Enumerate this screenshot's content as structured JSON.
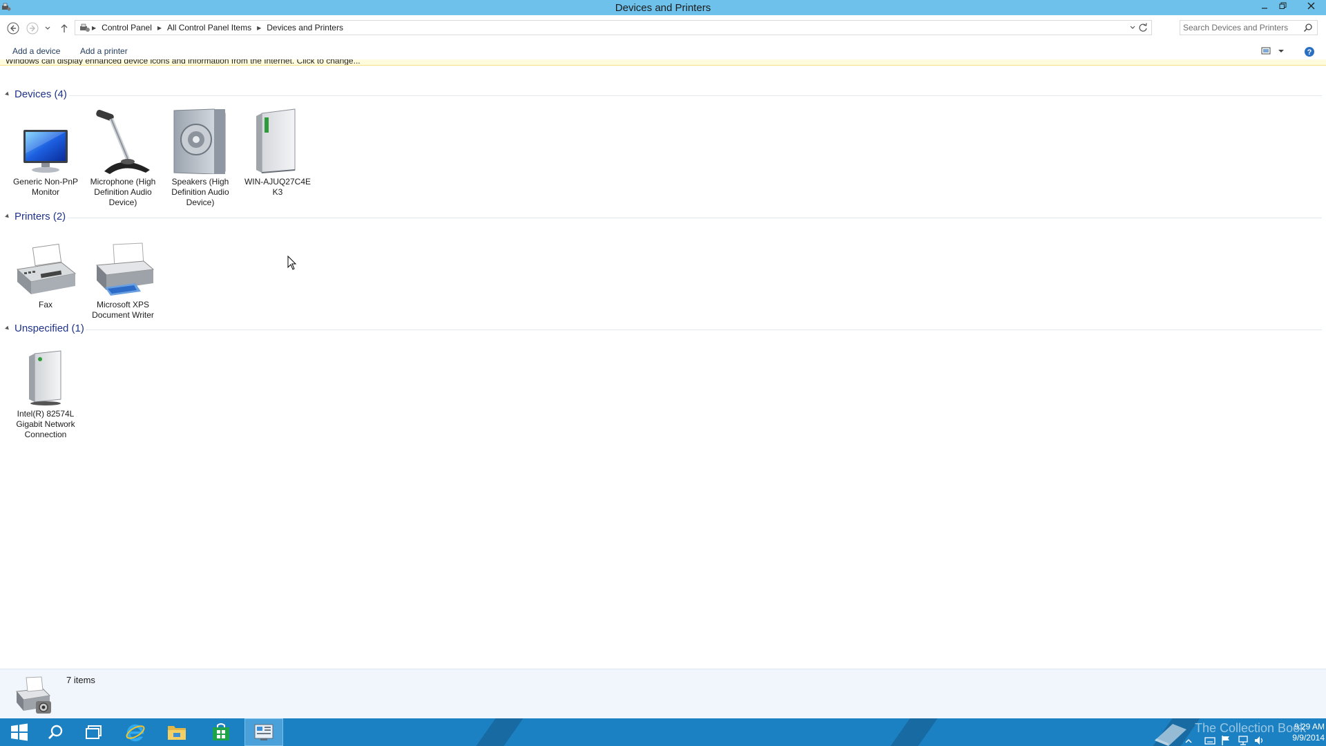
{
  "window": {
    "title": "Devices and Printers"
  },
  "address": {
    "crumbs": [
      "Control Panel",
      "All Control Panel Items",
      "Devices and Printers"
    ]
  },
  "search": {
    "placeholder": "Search Devices and Printers"
  },
  "commands": {
    "add_device": "Add a device",
    "add_printer": "Add a printer"
  },
  "infobar": {
    "text": "Windows can display enhanced device icons and information from the Internet. Click to change..."
  },
  "groups": {
    "devices": {
      "header": "Devices (4)",
      "items": [
        {
          "label": "Generic Non-PnP Monitor",
          "icon": "monitor-icon"
        },
        {
          "label": "Microphone (High Definition Audio Device)",
          "icon": "microphone-icon"
        },
        {
          "label": "Speakers (High Definition Audio Device)",
          "icon": "speaker-icon"
        },
        {
          "label": "WIN-AJUQ27C4E K3",
          "icon": "computer-icon"
        }
      ]
    },
    "printers": {
      "header": "Printers (2)",
      "items": [
        {
          "label": "Fax",
          "icon": "fax-icon"
        },
        {
          "label": "Microsoft XPS Document Writer",
          "icon": "printer-icon"
        }
      ]
    },
    "unspecified": {
      "header": "Unspecified (1)",
      "items": [
        {
          "label": "Intel(R) 82574L Gigabit Network Connection",
          "icon": "network-adapter-icon"
        }
      ]
    }
  },
  "status": {
    "item_count": "7 items"
  },
  "taskbar": {
    "watermark": "The Collection Book",
    "time": "9:29 AM",
    "date": "9/9/2014"
  },
  "colors": {
    "titlebar": "#6ec1ea",
    "taskbar": "#1c81c2",
    "group_header": "#1e3287"
  }
}
